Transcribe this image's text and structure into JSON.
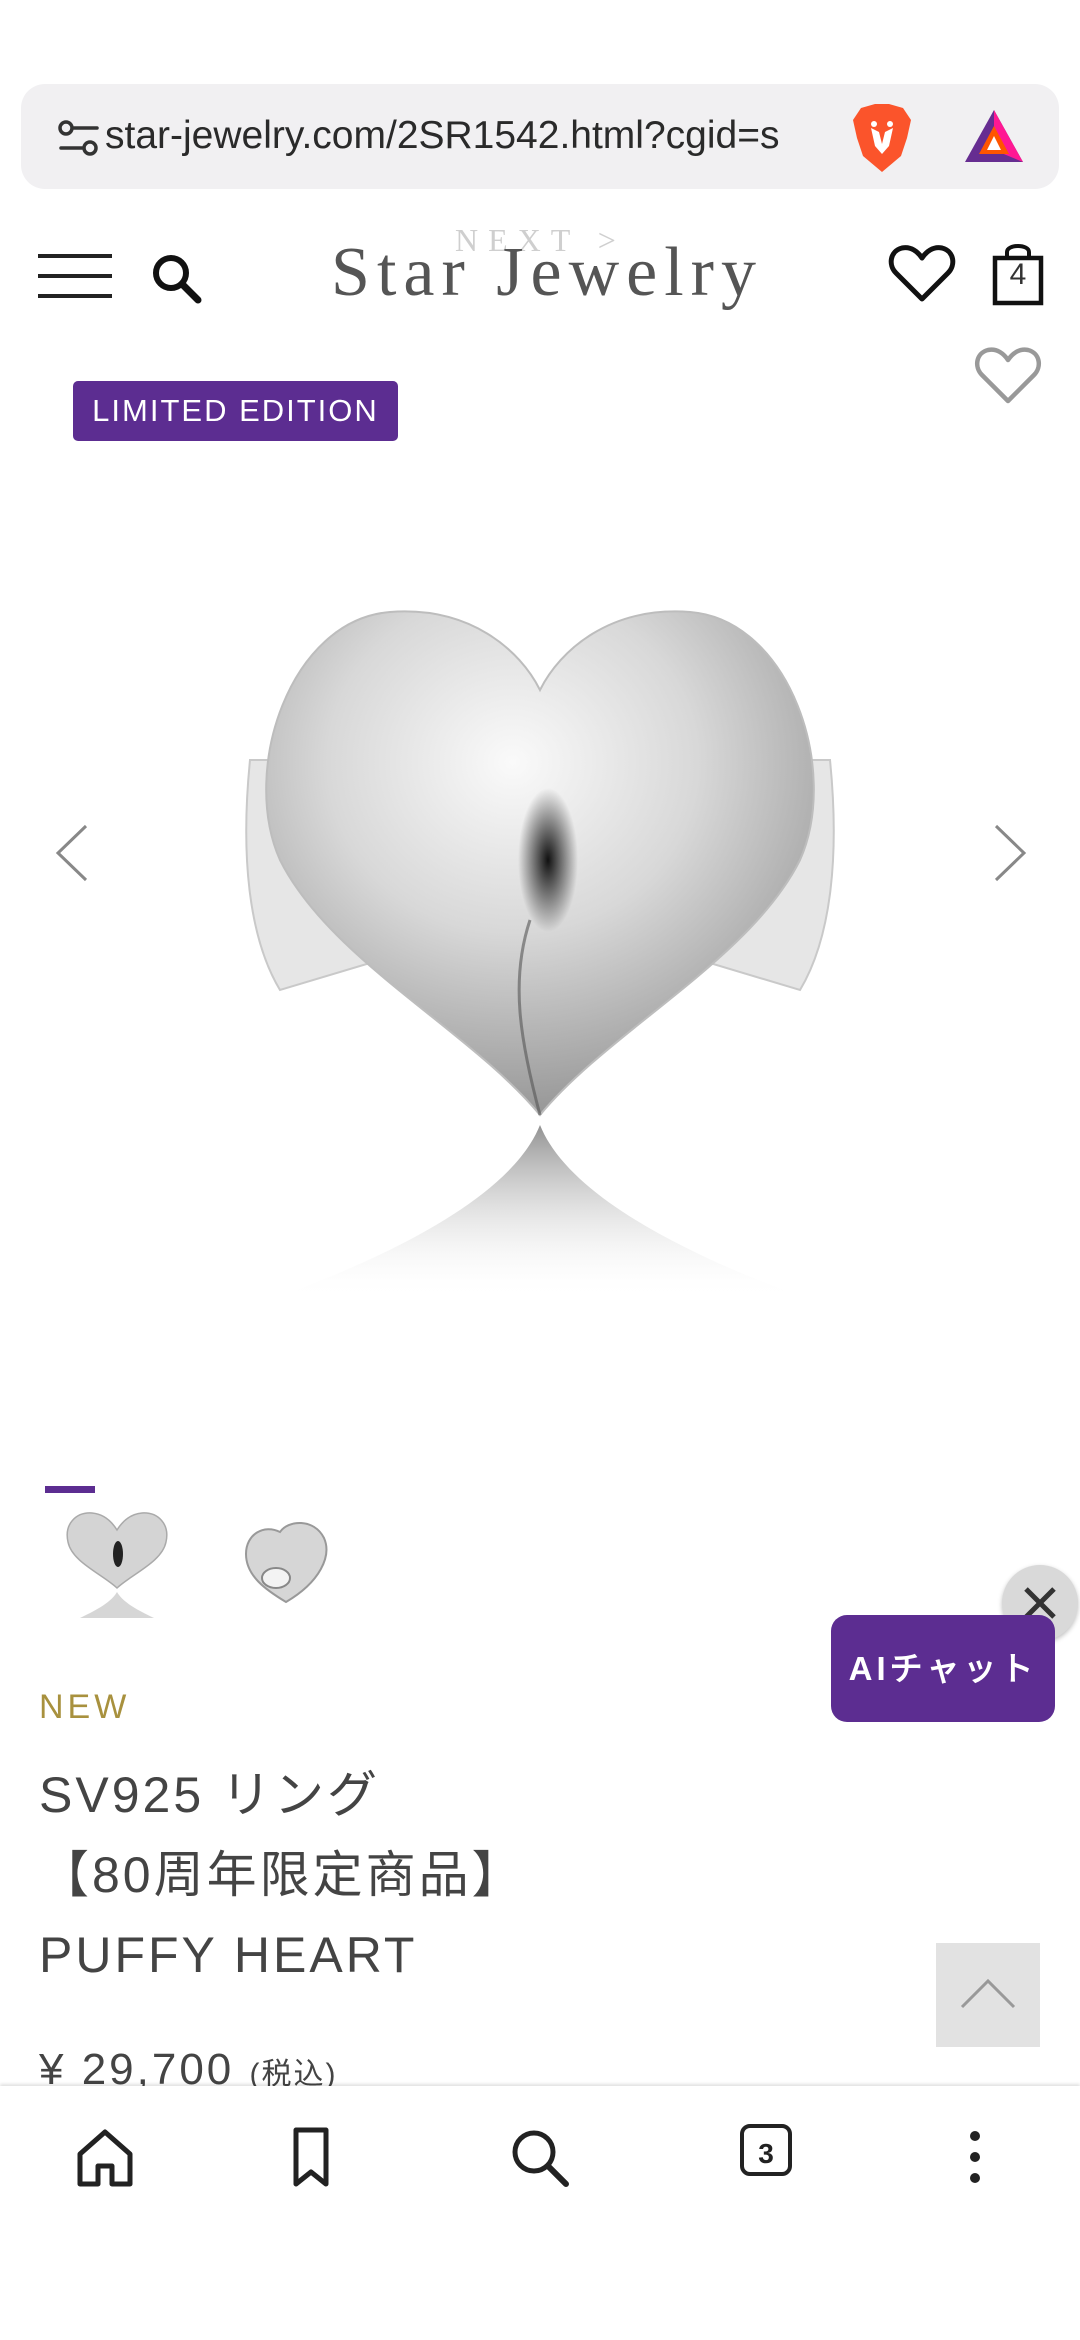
{
  "browser": {
    "url": "star-jewelry.com/2SR1542.html?cgid=s",
    "tabs_count": "3",
    "icons": [
      "tune-icon",
      "brave-lion-icon",
      "brave-rewards-icon",
      "home-icon",
      "bookmark-icon",
      "search-icon",
      "tabs-icon",
      "more-vert-icon"
    ]
  },
  "header": {
    "logo": "Star Jewelry",
    "ghost_text": "NEXT  >",
    "cart_count": "4",
    "icons": [
      "hamburger-icon",
      "search-icon",
      "heart-icon",
      "shopping-bag-icon"
    ]
  },
  "product": {
    "badge": "LIMITED EDITION",
    "new_label": "NEW",
    "title_lines": [
      "SV925 リング",
      "【80周年限定商品】",
      "PUFFY HEART"
    ],
    "price": "¥ 29,700",
    "price_tax": "(税込)"
  },
  "chat": {
    "label": "AIチャット"
  },
  "colors": {
    "accent_purple": "#5c2d91",
    "new_gold": "#a8913e",
    "background": "#ffffff"
  }
}
